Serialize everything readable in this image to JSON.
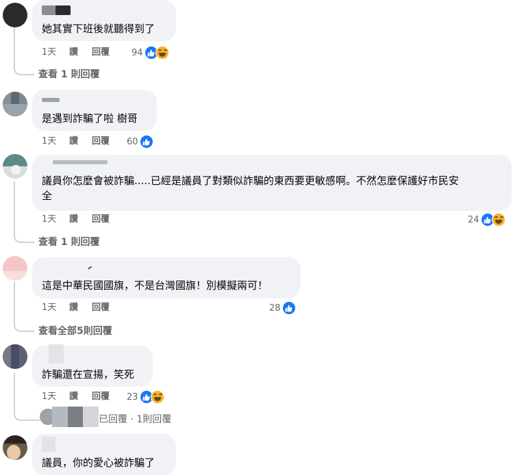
{
  "comments": [
    {
      "text": "她其實下班後就聽得到了",
      "time": "1天",
      "like": "讚",
      "reply": "回覆",
      "reaction_count": "94",
      "replies_link": "查看 1 則回覆"
    },
    {
      "text": "是遇到詐騙了啦 樹哥",
      "time": "1天",
      "like": "讚",
      "reply": "回覆",
      "reaction_count": "60"
    },
    {
      "text_line1": "議員你怎麼會被詐騙.....已經是議員了對類似詐騙的東西要更敏感啊。不然怎麼保護好市民安",
      "text_line2": "全",
      "time": "1天",
      "like": "讚",
      "reply": "回覆",
      "reaction_count": "24",
      "replies_link": "查看 1 則回覆"
    },
    {
      "text": "這是中華民國國旗，不是台灣國旗！別模擬兩可！",
      "time": "1天",
      "like": "讚",
      "reply": "回覆",
      "reaction_count": "28",
      "replies_link": "查看全部5則回覆"
    },
    {
      "text": "詐騙還在宣揚，笑死",
      "time": "1天",
      "like": "讚",
      "reply": "回覆",
      "reaction_count": "23",
      "replies_link": "已回覆 · 1則回覆"
    },
    {
      "text": "議員，你的愛心被詐騙了"
    }
  ],
  "icons": {
    "like": "like-thumb-icon",
    "haha": "haha-emoji-icon"
  },
  "colors": {
    "bubble": "#f0f2f5",
    "like_blue": "#1877f2",
    "secondary_text": "#65676b"
  }
}
